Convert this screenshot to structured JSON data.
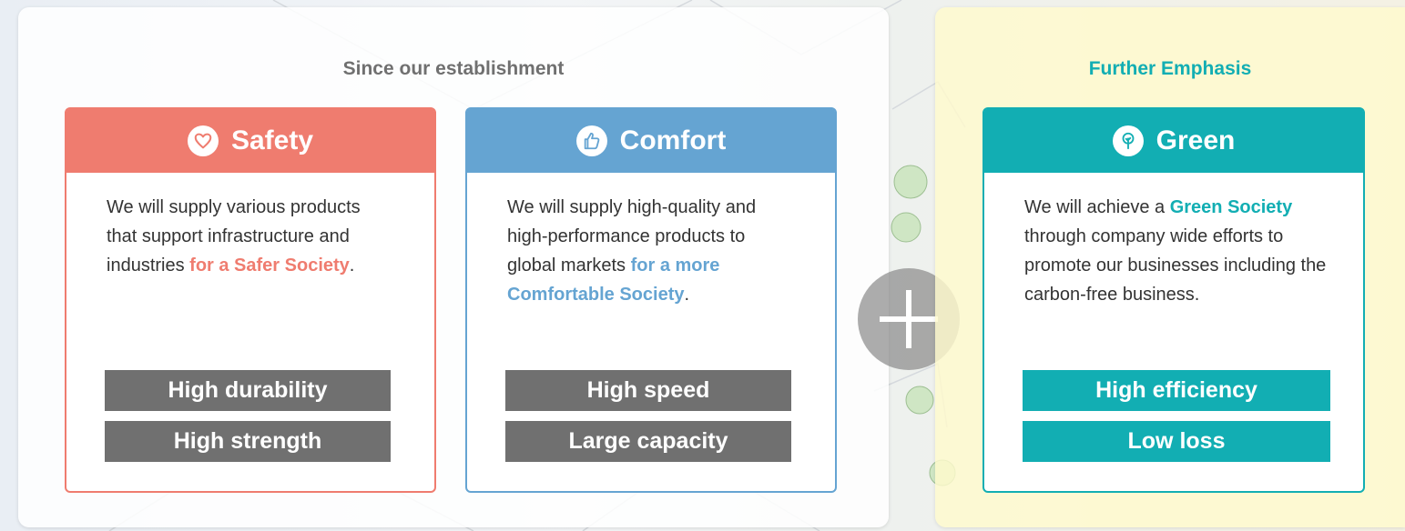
{
  "left_panel": {
    "heading": "Since our establishment"
  },
  "right_panel": {
    "heading": "Further Emphasis"
  },
  "cards": {
    "safety": {
      "title": "Safety",
      "icon": "heart-icon",
      "text_before": "We will supply various products that support infrastructure and industries ",
      "highlight": "for a Safer Society",
      "text_after": ".",
      "features": [
        "High durability",
        "High strength"
      ]
    },
    "comfort": {
      "title": "Comfort",
      "icon": "thumbs-up-icon",
      "text_before": "We will supply high-quality and high-performance products to global markets ",
      "highlight": "for a more Comfortable Society",
      "text_after": ".",
      "features": [
        "High speed",
        "Large capacity"
      ]
    },
    "green": {
      "title": "Green",
      "icon": "tree-icon",
      "text_before": "We will achieve a ",
      "highlight": "Green Society",
      "text_after": " through company wide efforts to promote our businesses including the carbon-free business.",
      "features": [
        "High efficiency",
        "Low loss"
      ]
    }
  },
  "colors": {
    "safety": "#ef7c6f",
    "comfort": "#65a4d2",
    "green": "#12aeb3",
    "feature_gray": "#707070"
  },
  "connector_icon": "plus-icon"
}
